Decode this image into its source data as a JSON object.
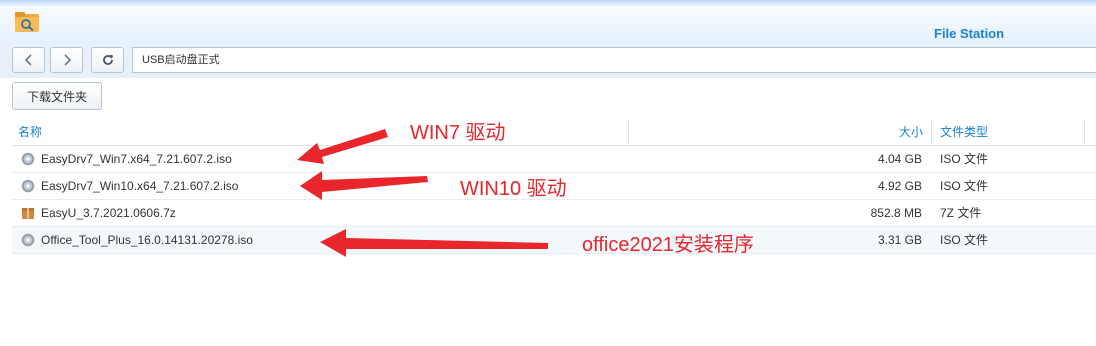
{
  "header": {
    "app_title": "File Station"
  },
  "toolbar": {
    "back_icon": "chevron-left-icon",
    "forward_icon": "chevron-right-icon",
    "refresh_icon": "refresh-icon",
    "path": "USB启动盘正式"
  },
  "actions": {
    "download_folder": "下载文件夹"
  },
  "columns": {
    "name": "名称",
    "size": "大小",
    "type": "文件类型"
  },
  "files": [
    {
      "name": "EasyDrv7_Win7.x64_7.21.607.2.iso",
      "size": "4.04 GB",
      "type": "ISO 文件",
      "icon": "disc-icon"
    },
    {
      "name": "EasyDrv7_Win10.x64_7.21.607.2.iso",
      "size": "4.92 GB",
      "type": "ISO 文件",
      "icon": "disc-icon"
    },
    {
      "name": "EasyU_3.7.2021.0606.7z",
      "size": "852.8 MB",
      "type": "7Z 文件",
      "icon": "archive-icon"
    },
    {
      "name": "Office_Tool_Plus_16.0.14131.20278.iso",
      "size": "3.31 GB",
      "type": "ISO 文件",
      "icon": "disc-icon"
    }
  ],
  "annotations": [
    "WIN7 驱动",
    "WIN10 驱动",
    "office2021安装程序"
  ],
  "colors": {
    "accent": "#1a82d1",
    "annotation": "#e8262b",
    "selected_row": "#f3f8fd"
  }
}
